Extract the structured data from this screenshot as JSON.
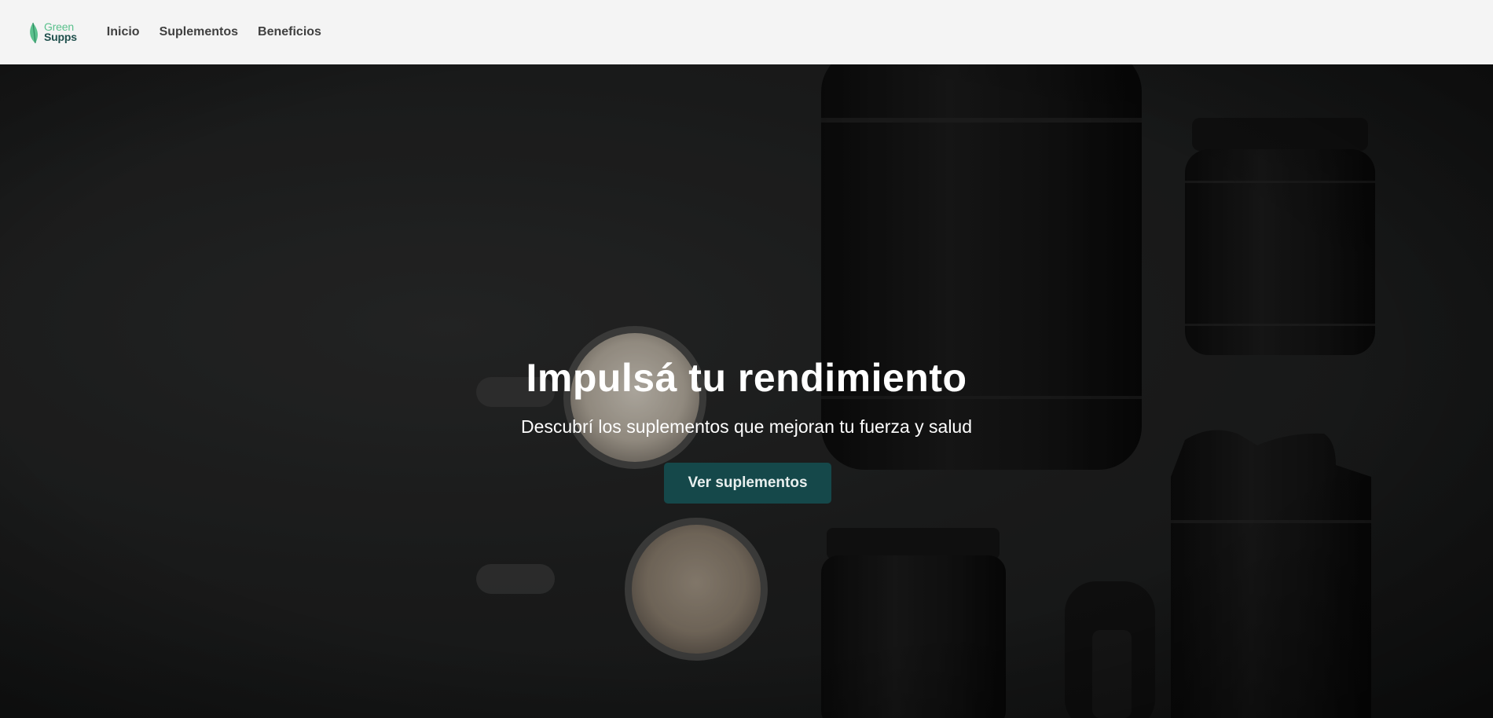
{
  "brand": {
    "line1": "Green",
    "line2": "Supps",
    "colors": {
      "primary": "#5bc18d",
      "dark": "#1f4f4c"
    }
  },
  "nav": {
    "items": [
      {
        "label": "Inicio"
      },
      {
        "label": "Suplementos"
      },
      {
        "label": "Beneficios"
      }
    ]
  },
  "hero": {
    "title": "Impulsá tu rendimiento",
    "subtitle": "Descubrí los suplementos que mejoran tu fuerza y salud",
    "cta_label": "Ver suplementos",
    "cta_color": "#15484a"
  },
  "icons": [
    "leaf-icon"
  ]
}
